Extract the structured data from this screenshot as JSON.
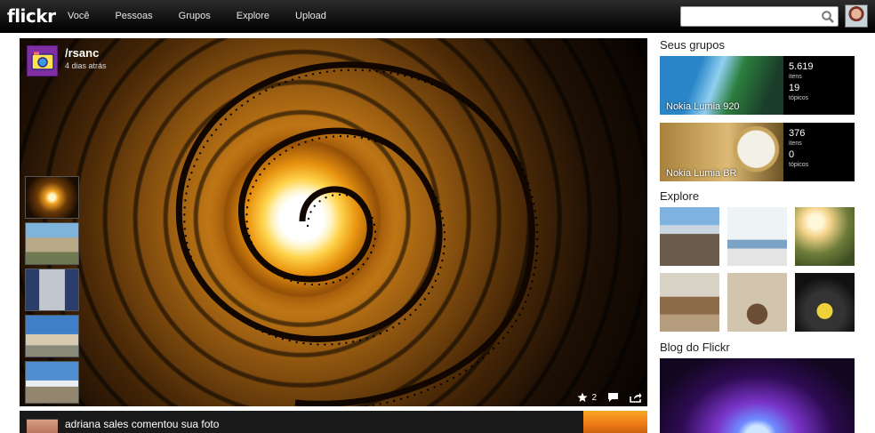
{
  "app": {
    "logo": "flickr"
  },
  "nav": {
    "items": [
      "Você",
      "Pessoas",
      "Grupos",
      "Explore",
      "Upload"
    ]
  },
  "search": {
    "placeholder": "",
    "value": ""
  },
  "photo": {
    "uploader": "/rsanc",
    "time": "4 dias atrás",
    "fav_count": "2"
  },
  "activity": {
    "text": "adriana sales comentou sua foto"
  },
  "sidebar": {
    "groups_title": "Seus grupos",
    "groups": [
      {
        "name": "Nokia Lumia 920",
        "items": "5.619",
        "items_label": "itens",
        "topics": "19",
        "topics_label": "tópicos"
      },
      {
        "name": "Nokia Lumia BR",
        "items": "376",
        "items_label": "itens",
        "topics": "0",
        "topics_label": "tópicos"
      }
    ],
    "explore_title": "Explore",
    "blog_title": "Blog do Flickr"
  },
  "colors": {
    "topbar": "#111111",
    "accent": "#0063dc",
    "background": "#ffffff"
  }
}
